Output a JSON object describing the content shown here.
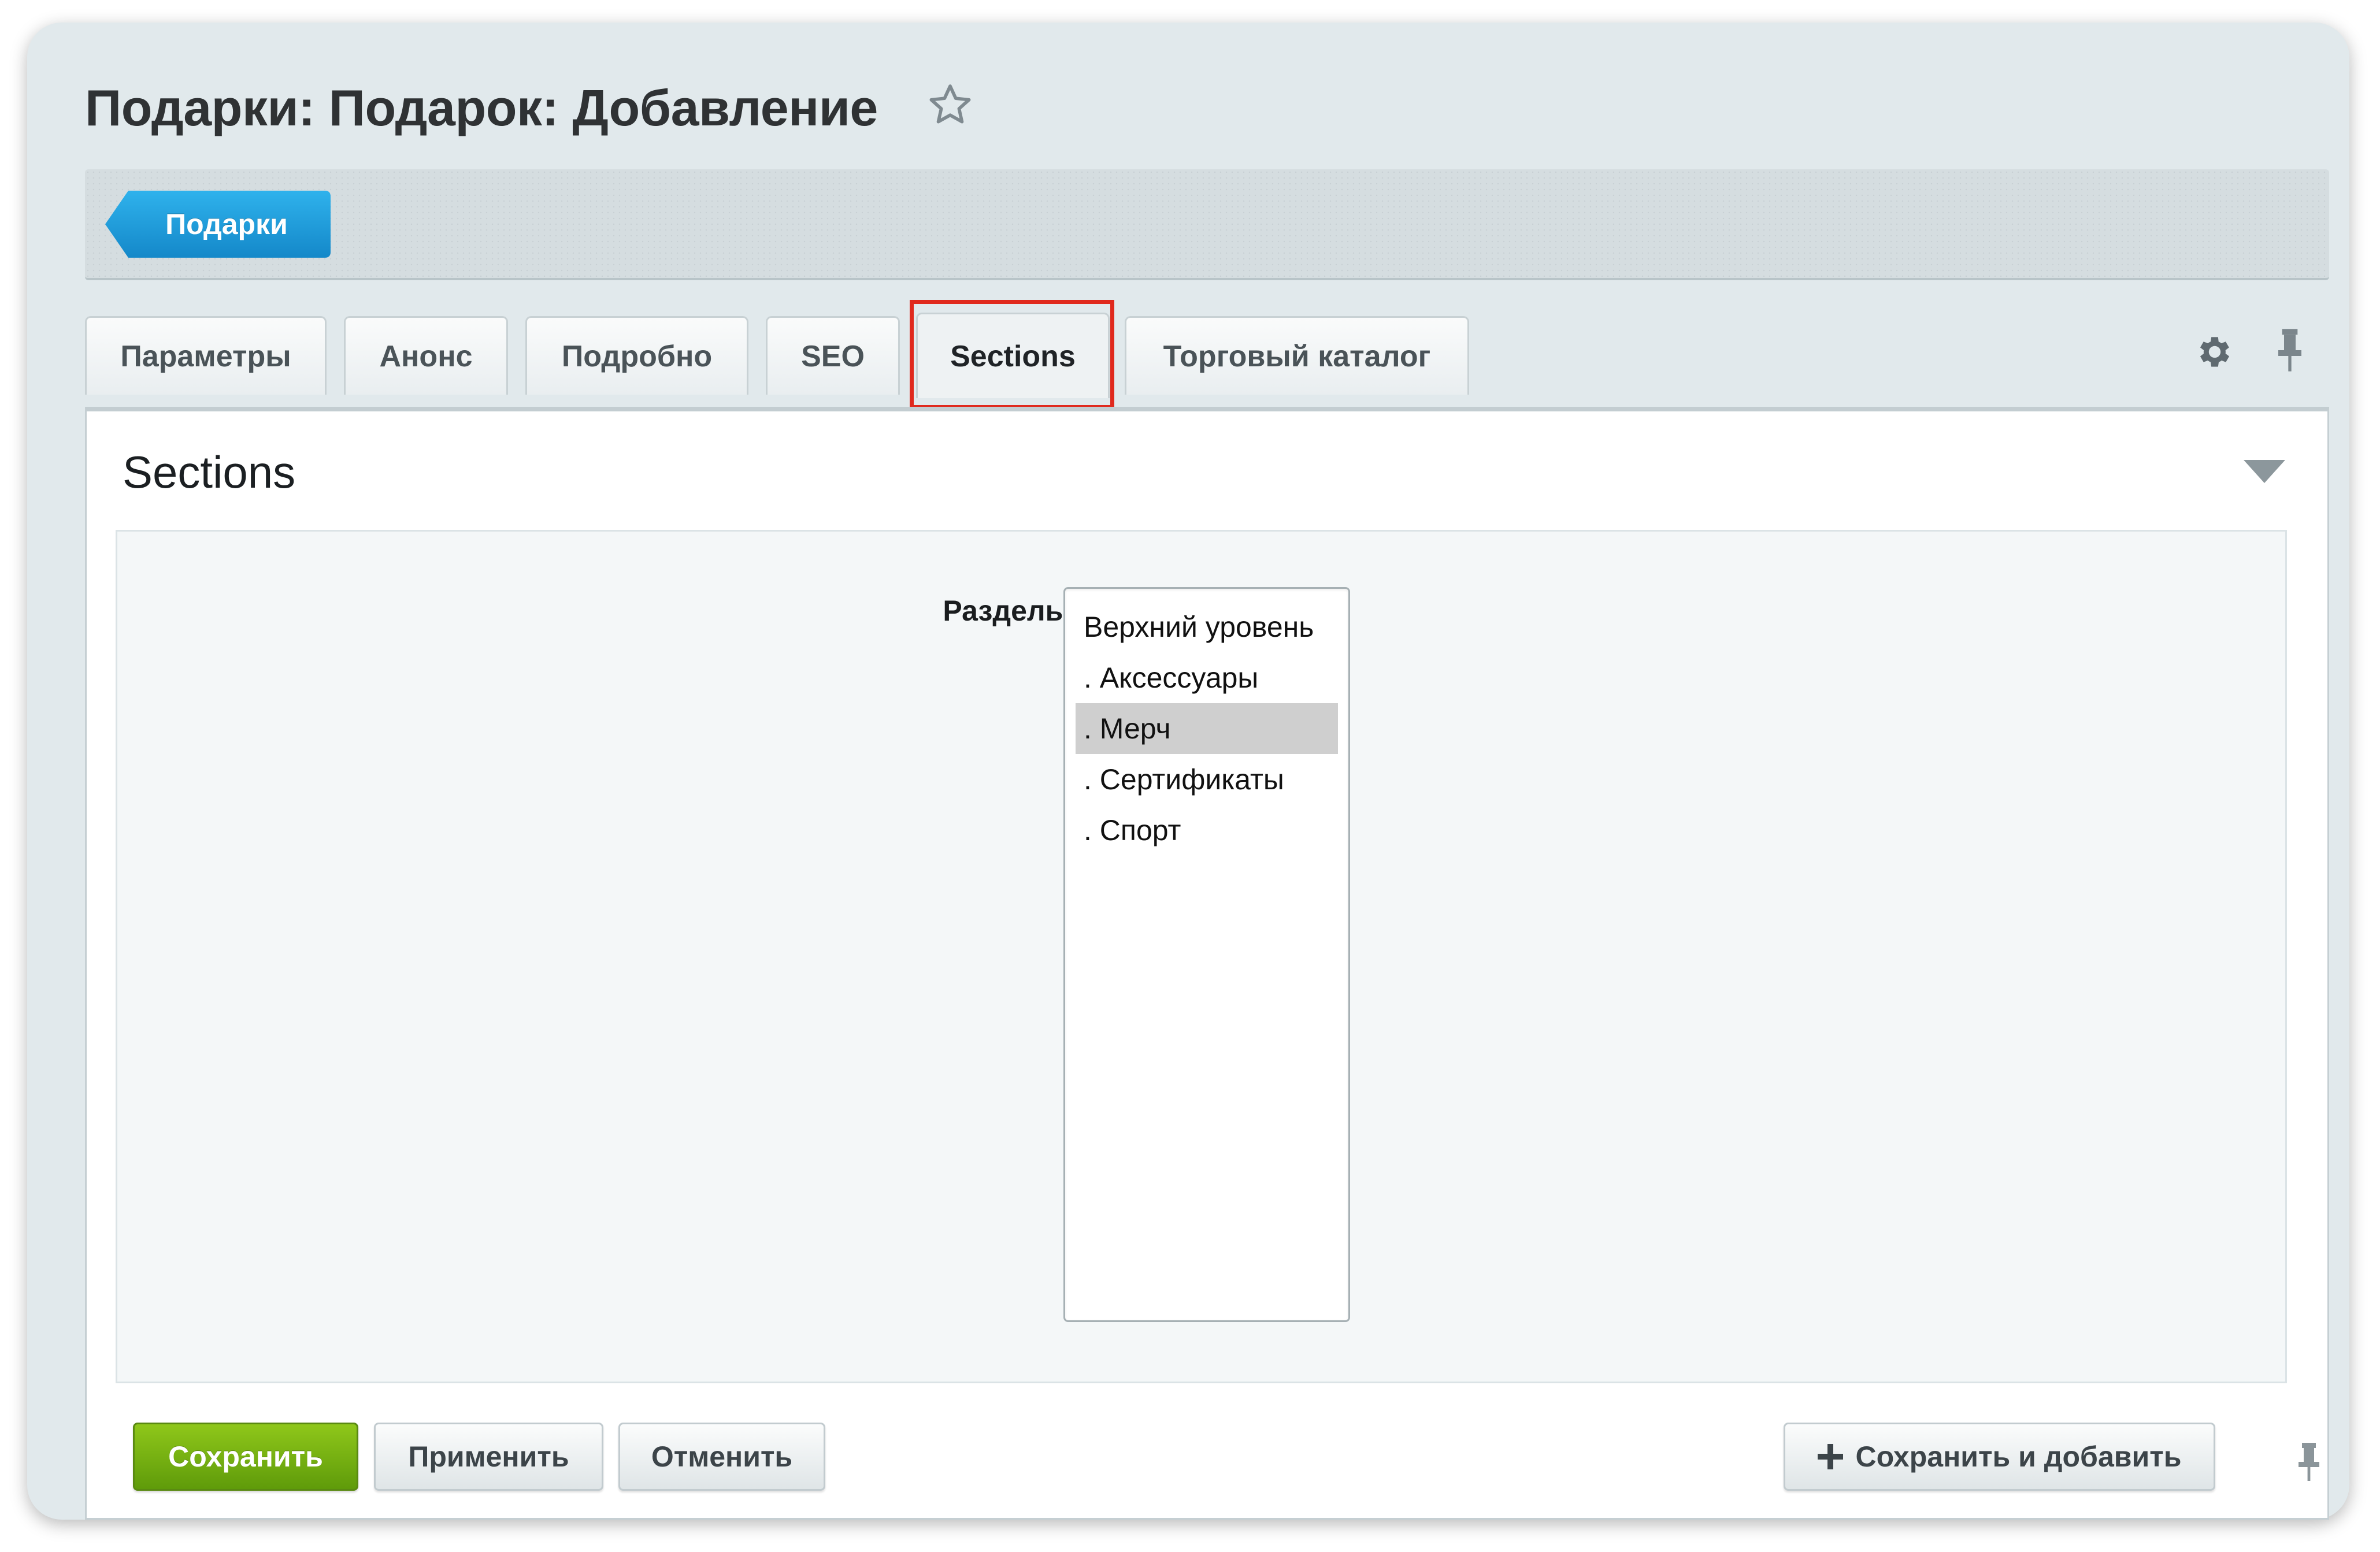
{
  "header": {
    "title": "Подарки: Подарок: Добавление"
  },
  "breadcrumb": {
    "items": [
      "Подарки"
    ]
  },
  "tabs": [
    {
      "label": "Параметры",
      "active": false
    },
    {
      "label": "Анонс",
      "active": false
    },
    {
      "label": "Подробно",
      "active": false
    },
    {
      "label": "SEO",
      "active": false
    },
    {
      "label": "Sections",
      "active": true
    },
    {
      "label": "Торговый каталог",
      "active": false
    }
  ],
  "section": {
    "title": "Sections",
    "field_label": "Разделы:",
    "options": [
      {
        "label": "Верхний уровень",
        "selected": false
      },
      {
        "label": ". Аксессуары",
        "selected": false
      },
      {
        "label": ". Мерч",
        "selected": true
      },
      {
        "label": ". Сертификаты",
        "selected": false
      },
      {
        "label": ". Спорт",
        "selected": false
      }
    ]
  },
  "footer": {
    "save_label": "Сохранить",
    "apply_label": "Применить",
    "cancel_label": "Отменить",
    "save_add_label": "Сохранить и добавить"
  },
  "colors": {
    "accent_blue": "#1d9ad9",
    "save_green": "#6aab10",
    "highlight_red": "#e0291d"
  },
  "icons": [
    "star-icon",
    "settings-gear-icon",
    "pin-icon",
    "collapse-arrow-icon",
    "plus-icon"
  ]
}
